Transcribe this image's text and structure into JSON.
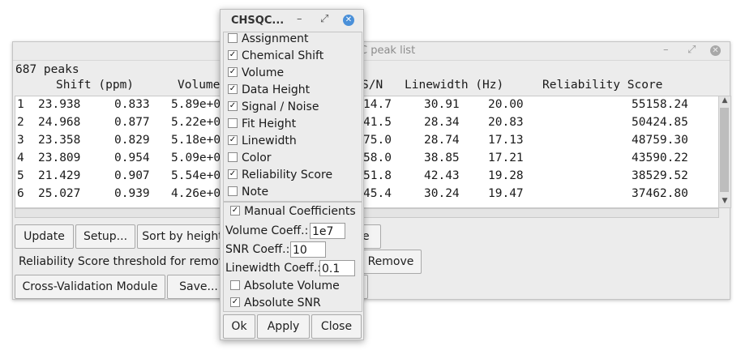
{
  "peak_window": {
    "title": "C peak list",
    "peak_count": "687 peaks",
    "columns": [
      "Shift (ppm)",
      "Volume",
      "S/N",
      "Linewidth (Hz)",
      "Reliability Score"
    ],
    "rows": [
      {
        "idx": "1",
        "s1": "23.938",
        "s2": "0.833",
        "vol": "5.89e+0",
        "sn": "14.7",
        "lw1": "30.91",
        "lw2": "20.00",
        "score": "55158.24"
      },
      {
        "idx": "2",
        "s1": "24.968",
        "s2": "0.877",
        "vol": "5.22e+0",
        "sn": "41.5",
        "lw1": "28.34",
        "lw2": "20.83",
        "score": "50424.85"
      },
      {
        "idx": "3",
        "s1": "23.358",
        "s2": "0.829",
        "vol": "5.18e+0",
        "sn": "75.0",
        "lw1": "28.74",
        "lw2": "17.13",
        "score": "48759.30"
      },
      {
        "idx": "4",
        "s1": "23.809",
        "s2": "0.954",
        "vol": "5.09e+0",
        "sn": "58.0",
        "lw1": "38.85",
        "lw2": "17.21",
        "score": "43590.22"
      },
      {
        "idx": "5",
        "s1": "21.429",
        "s2": "0.907",
        "vol": "5.54e+0",
        "sn": "51.8",
        "lw1": "42.43",
        "lw2": "19.28",
        "score": "38529.52"
      },
      {
        "idx": "6",
        "s1": "25.027",
        "s2": "0.939",
        "vol": "4.26e+0",
        "sn": "45.4",
        "lw1": "30.24",
        "lw2": "19.47",
        "score": "37462.80"
      }
    ],
    "buttons": {
      "update": "Update",
      "setup": "Setup...",
      "sort_by_height": "Sort by height",
      "hidden_button_tail": "e",
      "remove": "Remove",
      "cross_validation": "Cross-Validation Module",
      "save": "Save..."
    },
    "threshold_label": "Reliability Score threshold for removin"
  },
  "dialog": {
    "title": "CHSQC...",
    "checkboxes": [
      {
        "label": "Assignment",
        "checked": false
      },
      {
        "label": "Chemical Shift",
        "checked": true
      },
      {
        "label": "Volume",
        "checked": true
      },
      {
        "label": "Data Height",
        "checked": true
      },
      {
        "label": "Signal / Noise",
        "checked": true
      },
      {
        "label": "Fit Height",
        "checked": false
      },
      {
        "label": "Linewidth",
        "checked": true
      },
      {
        "label": "Color",
        "checked": false
      },
      {
        "label": "Reliability Score",
        "checked": true
      },
      {
        "label": "Note",
        "checked": false
      }
    ],
    "manual_coefficients": {
      "label": "Manual Coefficients",
      "checked": true
    },
    "volume_coeff": {
      "label": "Volume Coeff.:",
      "value": "1e7"
    },
    "snr_coeff": {
      "label": "SNR Coeff.:",
      "value": "10"
    },
    "linewidth_coeff": {
      "label": "Linewidth Coeff.:",
      "value": "0.1"
    },
    "absolute_volume": {
      "label": "Absolute Volume",
      "checked": false
    },
    "absolute_snr": {
      "label": "Absolute SNR",
      "checked": true
    },
    "buttons": {
      "ok": "Ok",
      "apply": "Apply",
      "close": "Close"
    }
  },
  "icons": {
    "minimize": "minimize-icon",
    "maximize": "maximize-icon",
    "close": "close-icon",
    "checkmark": "check-icon",
    "scroll_up": "arrow-up-icon",
    "scroll_down": "arrow-down-icon"
  },
  "colors": {
    "dialog_close": "#4a90d9",
    "window_bg": "#ececec",
    "list_bg": "#ffffff"
  }
}
